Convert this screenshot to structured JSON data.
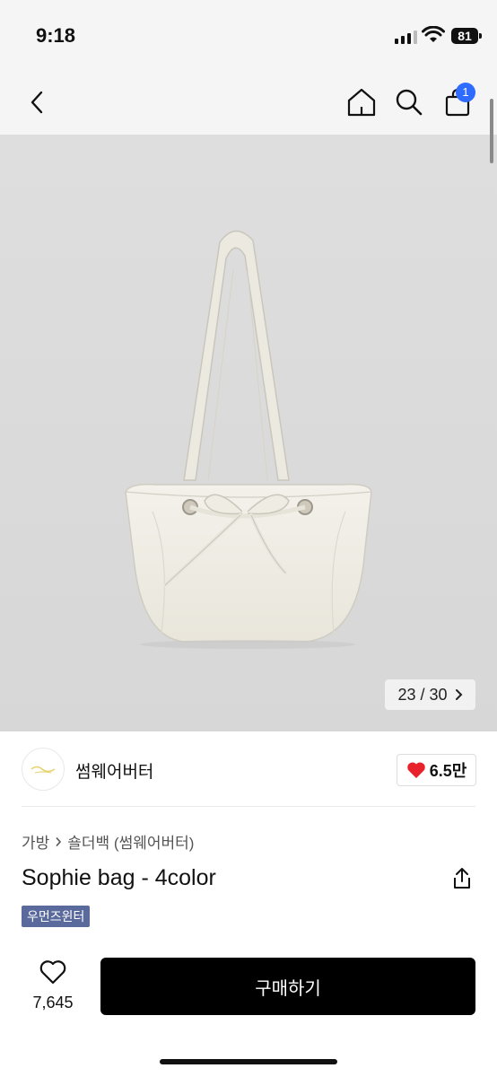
{
  "status_bar": {
    "time": "9:18",
    "battery": "81"
  },
  "nav": {
    "cart_count": "1"
  },
  "gallery": {
    "counter": "23 / 30"
  },
  "shop": {
    "name": "썸웨어버터",
    "likes": "6.5만"
  },
  "product": {
    "breadcrumb": {
      "category": "가방",
      "subcategory": "숄더백 (썸웨어버터)"
    },
    "title": "Sophie bag - 4color",
    "tag": "우먼즈윈터"
  },
  "bottom_bar": {
    "wish_count": "7,645",
    "buy_label": "구매하기"
  },
  "colors": {
    "accent_blue": "#2f6bff",
    "tag_bg": "#5b6a9c",
    "heart_red": "#e8222b"
  }
}
